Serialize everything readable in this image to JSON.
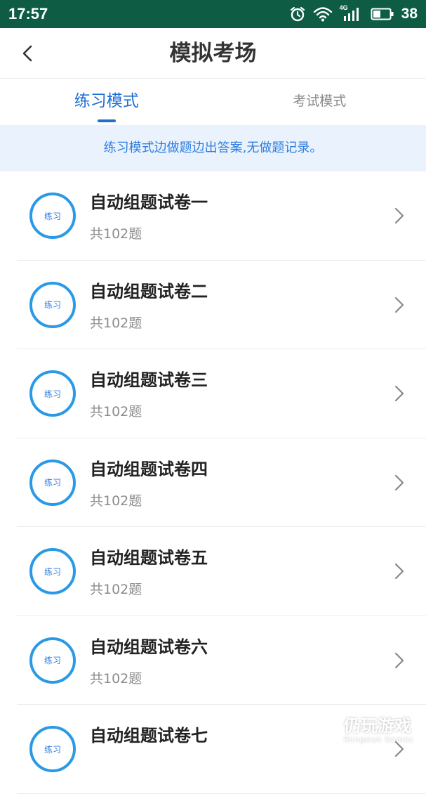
{
  "status_bar": {
    "time": "17:57",
    "network_label": "4G",
    "battery": "38",
    "bg_color": "#0d5c43",
    "icons": [
      "alarm-icon",
      "wifi-icon",
      "signal-icon",
      "battery-icon"
    ]
  },
  "header": {
    "title": "模拟考场",
    "back_icon": "chevron-left-icon"
  },
  "tabs": [
    {
      "label": "练习模式",
      "active": true
    },
    {
      "label": "考试模式",
      "active": false
    }
  ],
  "notice": {
    "text": "练习模式边做题边出答案,无做题记录。"
  },
  "exam_list": {
    "badge_label": "练习",
    "items": [
      {
        "title": "自动组题试卷一",
        "count": "共102题"
      },
      {
        "title": "自动组题试卷二",
        "count": "共102题"
      },
      {
        "title": "自动组题试卷三",
        "count": "共102题"
      },
      {
        "title": "自动组题试卷四",
        "count": "共102题"
      },
      {
        "title": "自动组题试卷五",
        "count": "共102题"
      },
      {
        "title": "自动组题试卷六",
        "count": "共102题"
      },
      {
        "title": "自动组题试卷七",
        "count": ""
      }
    ]
  },
  "watermark": {
    "cn": "仍玩游戏",
    "en": "Rengwan Games"
  },
  "colors": {
    "accent": "#1e6fd2",
    "ring": "#2a9ae6",
    "notice_bg": "#eaf3fd"
  }
}
